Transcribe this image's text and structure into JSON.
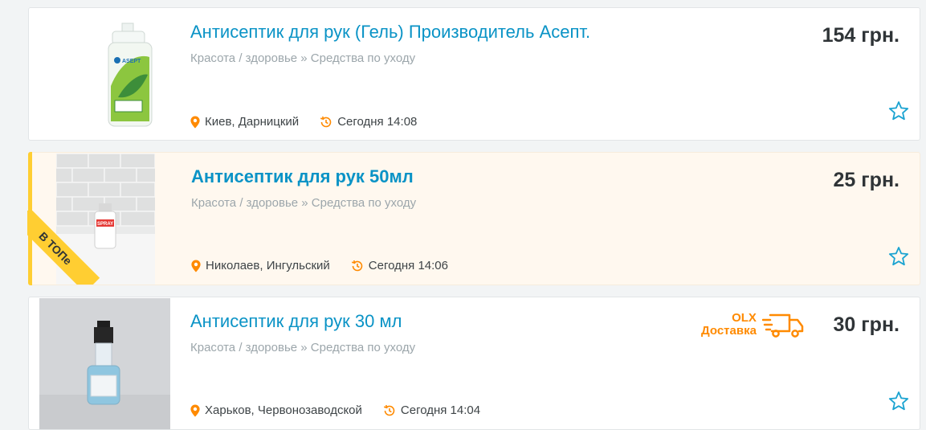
{
  "listings": [
    {
      "title": "Антисептик для рук (Гель) Производитель Асепт.",
      "category": "Красота / здоровье » Средства по уходу",
      "price": "154 грн.",
      "location": "Киев, Дарницкий",
      "time": "Сегодня 14:08",
      "image_label": "ASEPT",
      "top": false
    },
    {
      "title": "Антисептик для рук 50мл",
      "category": "Красота / здоровье » Средства по уходу",
      "price": "25 грн.",
      "location": "Николаев, Ингульский",
      "time": "Сегодня 14:06",
      "image_label": "SPRAY",
      "top": true,
      "top_badge": "В ТОПе"
    },
    {
      "title": "Антисептик для рук 30 мл",
      "category": "Красота / здоровье » Средства по уходу",
      "price": "30 грн.",
      "location": "Харьков, Червонозаводской",
      "time": "Сегодня 14:04",
      "top": false,
      "delivery": {
        "line1": "OLX",
        "line2": "Доставка"
      }
    }
  ],
  "colors": {
    "title": "#0a93c6",
    "accent_orange": "#ff8a00",
    "top_yellow": "#ffce32",
    "star_blue": "#1aa3d1"
  },
  "icons": {
    "location": "map-pin-icon",
    "time": "clock-history-icon",
    "favorite": "star-outline-icon",
    "delivery": "delivery-truck-icon"
  }
}
